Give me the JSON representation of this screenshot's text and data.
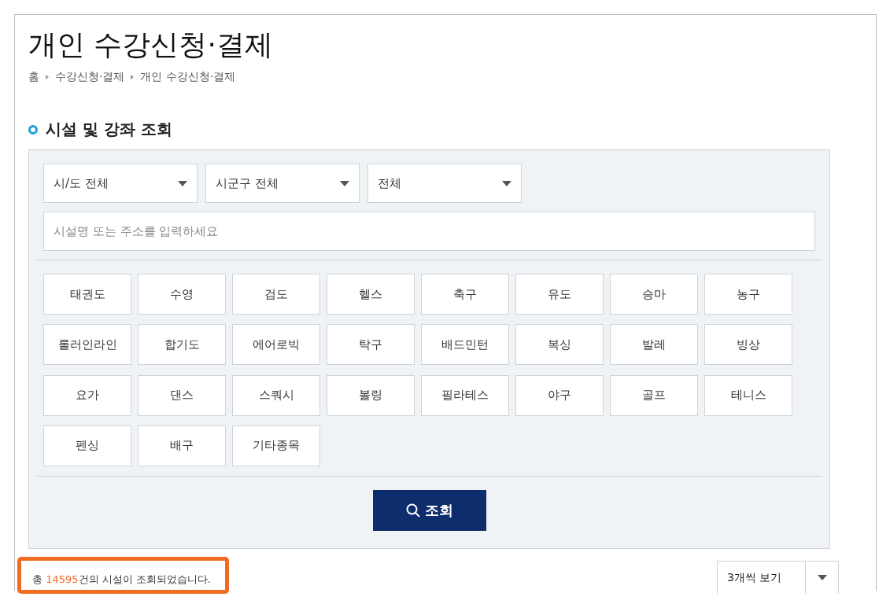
{
  "page": {
    "title": "개인 수강신청·결제",
    "breadcrumb": [
      "홈",
      "수강신청·결제",
      "개인 수강신청·결제"
    ]
  },
  "search_section": {
    "heading": "시설 및 강좌 조회",
    "selects": [
      {
        "value": "시/도 전체"
      },
      {
        "value": "시군구 전체"
      },
      {
        "value": "전체"
      }
    ],
    "search_field": {
      "placeholder": "시설명 또는 주소를 입력하세요"
    },
    "sports": [
      "태권도",
      "수영",
      "검도",
      "헬스",
      "축구",
      "유도",
      "승마",
      "농구",
      "롤러인라인",
      "합기도",
      "에어로빅",
      "탁구",
      "배드민턴",
      "복싱",
      "발레",
      "빙상",
      "요가",
      "댄스",
      "스쿼시",
      "볼링",
      "필라테스",
      "야구",
      "골프",
      "테니스",
      "펜싱",
      "배구",
      "기타종목"
    ],
    "search_button": "조회"
  },
  "results": {
    "prefix": "총 ",
    "count": "14595",
    "suffix": "건의 시설이 조회되었습니다.",
    "highlighted": true,
    "view_select": "3개씩 보기"
  }
}
